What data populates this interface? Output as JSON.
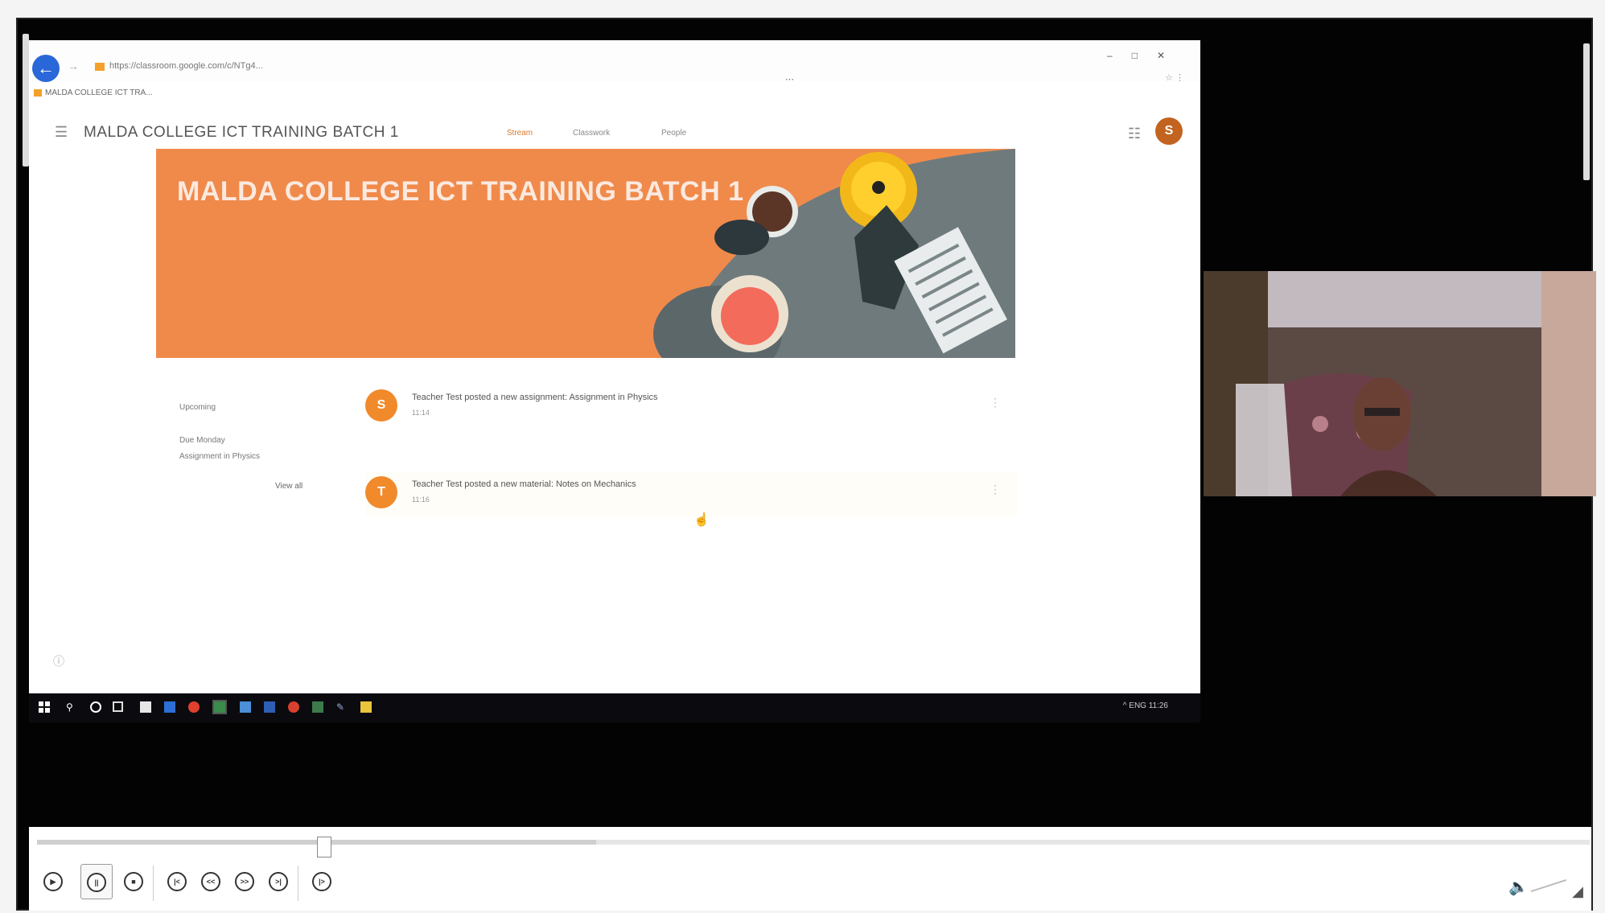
{
  "browser": {
    "url": "https://classroom.google.com/c/NTg4...",
    "bookmark": "MALDA COLLEGE ICT TRA...",
    "window_controls": [
      "–",
      "□",
      "✕"
    ]
  },
  "classroom": {
    "title": "MALDA COLLEGE ICT TRAINING BATCH 1",
    "tabs": [
      "Stream",
      "Classwork",
      "People"
    ],
    "avatar_letter": "S",
    "banner_title": "MALDA COLLEGE ICT TRAINING BATCH 1",
    "upcoming": {
      "label": "Upcoming",
      "due": "Due Monday",
      "item": "Assignment in Physics",
      "view_all": "View all"
    },
    "posts": [
      {
        "avatar": "S",
        "text": "Teacher Test posted a new assignment: Assignment in Physics",
        "time": "11:14"
      },
      {
        "avatar": "T",
        "text": "Teacher Test posted a new material: Notes on Mechanics",
        "time": "11:16"
      }
    ]
  },
  "taskbar": {
    "tray_text": "^  ENG  11:26"
  },
  "player": {
    "seek_fraction": 0.36,
    "controls": [
      "play",
      "pause",
      "stop",
      "skip-back",
      "rewind",
      "fast-forward",
      "skip-forward",
      "step"
    ]
  },
  "colors": {
    "accent": "#d97b2d",
    "banner": "#f08a4b",
    "browser_back": "#2a67d8"
  }
}
